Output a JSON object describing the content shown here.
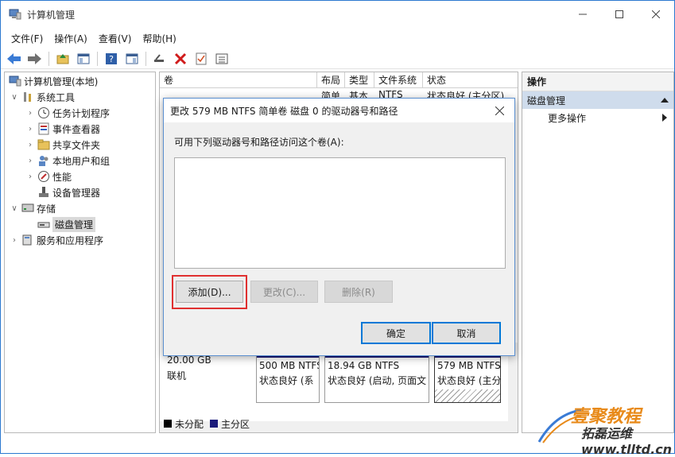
{
  "window": {
    "title": "计算机管理"
  },
  "menu": [
    "文件(F)",
    "操作(A)",
    "查看(V)",
    "帮助(H)"
  ],
  "tree": {
    "root": "计算机管理(本地)",
    "system_tools": "系统工具",
    "task_scheduler": "任务计划程序",
    "event_viewer": "事件查看器",
    "shared_folders": "共享文件夹",
    "local_users": "本地用户和组",
    "performance": "性能",
    "device_manager": "设备管理器",
    "storage": "存储",
    "disk_management": "磁盘管理",
    "services_apps": "服务和应用程序"
  },
  "volume_table": {
    "headers": [
      "卷",
      "布局",
      "类型",
      "文件系统",
      "状态"
    ],
    "row": [
      "",
      "简单",
      "基本",
      "NTFS",
      "状态良好 (主分区)"
    ]
  },
  "disk": {
    "size": "20.00 GB",
    "status": "联机",
    "partitions": [
      {
        "line1": "500 MB NTFS",
        "line2": "状态良好 (系"
      },
      {
        "line1": "18.94 GB NTFS",
        "line2": "状态良好 (启动, 页面文"
      },
      {
        "line1": "579 MB NTFS",
        "line2": "状态良好 (主分"
      }
    ]
  },
  "legend": {
    "unallocated": "未分配",
    "primary": "主分区",
    "unallocated_color": "#000000",
    "primary_color": "#1a1a7a"
  },
  "actions": {
    "header": "操作",
    "section": "磁盘管理",
    "more": "更多操作"
  },
  "dialog": {
    "title": "更改 579 MB NTFS 简单卷 磁盘 0 的驱动器号和路径",
    "prompt": "可用下列驱动器号和路径访问这个卷(A):",
    "add": "添加(D)...",
    "change": "更改(C)...",
    "remove": "删除(R)",
    "ok": "确定",
    "cancel": "取消"
  },
  "watermark": {
    "line1": "壹聚教程",
    "line2": "拓磊运维 www.tlltd.cn"
  }
}
